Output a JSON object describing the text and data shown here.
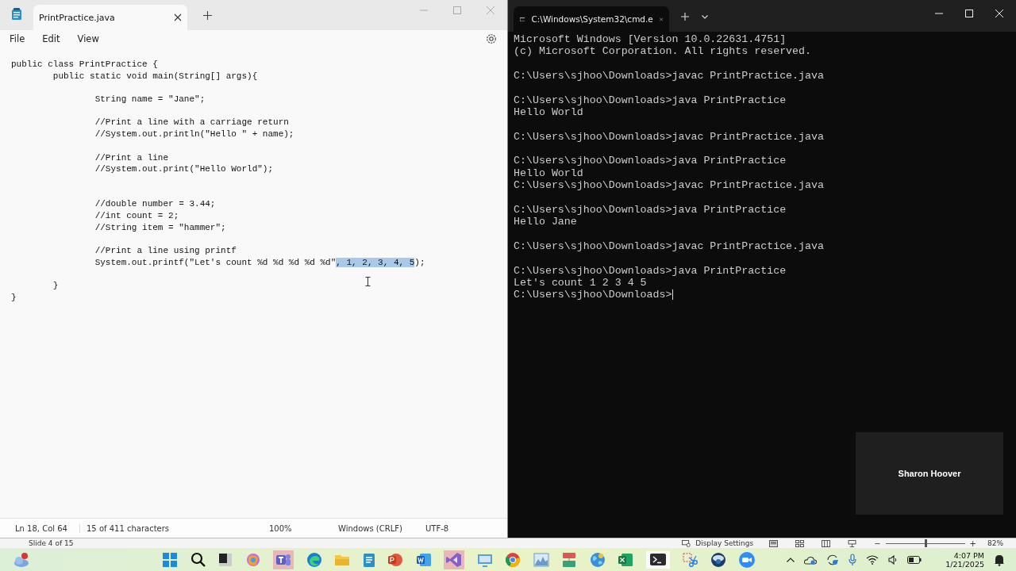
{
  "notepad": {
    "tab_title": "PrintPractice.java",
    "menu": [
      "File",
      "Edit",
      "View"
    ],
    "code_lines": [
      {
        "kind": "code",
        "segments": [
          {
            "text": "public class PrintPractice {",
            "selected": false
          }
        ]
      },
      {
        "kind": "code",
        "segments": [
          {
            "text": "\tpublic static void main(String[] args){",
            "selected": false
          }
        ]
      },
      {
        "kind": "blank"
      },
      {
        "kind": "code",
        "segments": [
          {
            "text": "\t\tString name = \"Jane\";",
            "selected": false
          }
        ]
      },
      {
        "kind": "blank"
      },
      {
        "kind": "code",
        "segments": [
          {
            "text": "\t\t//Print a line with a carriage return",
            "selected": false
          }
        ]
      },
      {
        "kind": "code",
        "segments": [
          {
            "text": "\t\t//System.out.println(\"Hello \" + name);",
            "selected": false
          }
        ]
      },
      {
        "kind": "blank"
      },
      {
        "kind": "code",
        "segments": [
          {
            "text": "\t\t//Print a line",
            "selected": false
          }
        ]
      },
      {
        "kind": "code",
        "segments": [
          {
            "text": "\t\t//System.out.print(\"Hello World\");",
            "selected": false
          }
        ]
      },
      {
        "kind": "blank"
      },
      {
        "kind": "blank"
      },
      {
        "kind": "code",
        "segments": [
          {
            "text": "\t\t//double number = 3.44;",
            "selected": false
          }
        ]
      },
      {
        "kind": "code",
        "segments": [
          {
            "text": "\t\t//int count = 2;",
            "selected": false
          }
        ]
      },
      {
        "kind": "code",
        "segments": [
          {
            "text": "\t\t//String item = \"hammer\";",
            "selected": false
          }
        ]
      },
      {
        "kind": "blank"
      },
      {
        "kind": "code",
        "segments": [
          {
            "text": "\t\t//Print a line using printf",
            "selected": false
          }
        ]
      },
      {
        "kind": "code",
        "segments": [
          {
            "text": "\t\tSystem.out.printf(\"Let's count %d %d %d %d %d\"",
            "selected": false
          },
          {
            "text": ", 1, 2, 3, 4, 5",
            "selected": true
          },
          {
            "text": ");",
            "selected": false
          }
        ]
      },
      {
        "kind": "blank"
      },
      {
        "kind": "code",
        "segments": [
          {
            "text": "\t}",
            "selected": false
          }
        ]
      },
      {
        "kind": "code",
        "segments": [
          {
            "text": "}",
            "selected": false
          }
        ]
      }
    ],
    "status_bar": [
      "Ln 18, Col 64",
      "15 of 411 characters",
      "100%",
      "Windows (CRLF)",
      "UTF-8"
    ]
  },
  "terminal": {
    "tab_title": "C:\\Windows\\System32\\cmd.e",
    "lines": [
      {
        "kind": "text",
        "text": "Microsoft Windows [Version 10.0.22631.4751]"
      },
      {
        "kind": "text",
        "text": "(c) Microsoft Corporation. All rights reserved."
      },
      {
        "kind": "blank"
      },
      {
        "kind": "text",
        "text": "C:\\Users\\sjhoo\\Downloads>javac PrintPractice.java"
      },
      {
        "kind": "blank"
      },
      {
        "kind": "text",
        "text": "C:\\Users\\sjhoo\\Downloads>java PrintPractice"
      },
      {
        "kind": "text",
        "text": "Hello World"
      },
      {
        "kind": "blank"
      },
      {
        "kind": "text",
        "text": "C:\\Users\\sjhoo\\Downloads>javac PrintPractice.java"
      },
      {
        "kind": "blank"
      },
      {
        "kind": "text",
        "text": "C:\\Users\\sjhoo\\Downloads>java PrintPractice"
      },
      {
        "kind": "text",
        "text": "Hello World"
      },
      {
        "kind": "text",
        "text": "C:\\Users\\sjhoo\\Downloads>javac PrintPractice.java"
      },
      {
        "kind": "blank"
      },
      {
        "kind": "text",
        "text": "C:\\Users\\sjhoo\\Downloads>java PrintPractice"
      },
      {
        "kind": "text",
        "text": "Hello Jane"
      },
      {
        "kind": "blank"
      },
      {
        "kind": "text",
        "text": "C:\\Users\\sjhoo\\Downloads>javac PrintPractice.java"
      },
      {
        "kind": "blank"
      },
      {
        "kind": "text",
        "text": "C:\\Users\\sjhoo\\Downloads>java PrintPractice"
      },
      {
        "kind": "text",
        "text": "Let's count 1 2 3 4 5"
      },
      {
        "kind": "prompt",
        "text": "C:\\Users\\sjhoo\\Downloads>"
      }
    ]
  },
  "video_tile": {
    "name": "Sharon Hoover"
  },
  "presentation_bar": {
    "slide_label": "Slide 4 of 15",
    "display_settings": "Display Settings",
    "zoom": {
      "out_label": "−",
      "in_label": "+",
      "level": 0.5,
      "reading": "82%"
    }
  },
  "taskbar": {
    "time": "4:07 PM",
    "date": "1/21/2025"
  }
}
